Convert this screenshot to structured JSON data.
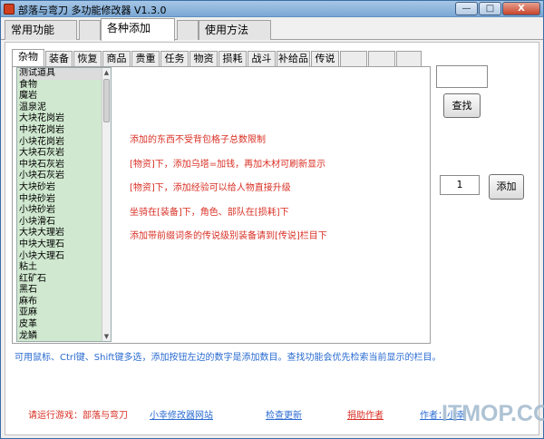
{
  "window": {
    "title": "部落与弯刀 多功能修改器 V1.3.0",
    "controls": {
      "minimize": "—",
      "maximize": "□",
      "close": "X"
    }
  },
  "main_tabs": [
    {
      "label": "常用功能",
      "active": false
    },
    {
      "label": "各种添加",
      "active": true
    },
    {
      "label": "使用方法",
      "active": false
    }
  ],
  "sub_tabs": [
    {
      "label": "杂物",
      "active": true
    },
    {
      "label": "装备"
    },
    {
      "label": "恢复"
    },
    {
      "label": "商品"
    },
    {
      "label": "贵重"
    },
    {
      "label": "任务"
    },
    {
      "label": "物资"
    },
    {
      "label": "损耗"
    },
    {
      "label": "战斗"
    },
    {
      "label": "补给品"
    },
    {
      "label": "传说"
    }
  ],
  "item_list": [
    "测试道具",
    "食物",
    "魔岩",
    "温泉泥",
    "大块花岗岩",
    "中块花岗岩",
    "小块花岗岩",
    "大块石灰岩",
    "中块石灰岩",
    "小块石灰岩",
    "大块砂岩",
    "中块砂岩",
    "小块砂岩",
    "小块滑石",
    "大块大理岩",
    "中块大理石",
    "小块大理石",
    "粘土",
    "红矿石",
    "黑石",
    "麻布",
    "亚麻",
    "皮革",
    "龙鳞"
  ],
  "notes": [
    "添加的东西不受背包格子总数限制",
    "[物资]下，添加乌塔=加钱，再加木材可刷新显示",
    "[物资]下，添加经验可以给人物直接升级",
    "坐骑在[装备]下，角色、部队在[损耗]下",
    "添加带前缀词条的传说级别装备请到[传说]栏目下"
  ],
  "search": {
    "value": "",
    "button_label": "查找"
  },
  "add": {
    "quantity": "1",
    "button_label": "添加"
  },
  "hint": "可用鼠标、Ctrl键、Shift键多选，添加按钮左边的数字是添加数目。查找功能会优先检索当前显示的栏目。",
  "footer": {
    "run_game": "请运行游戏：部落与弯刀",
    "site_link": "小幸修改器网站",
    "update_link": "检查更新",
    "donate_link": "捐助作者",
    "author_link": "作者：小幸"
  },
  "watermark": "ITMOP.COM",
  "colors": {
    "note_red": "#d93025",
    "link_blue": "#2a6bd1",
    "list_bg": "#cfe8cf"
  }
}
